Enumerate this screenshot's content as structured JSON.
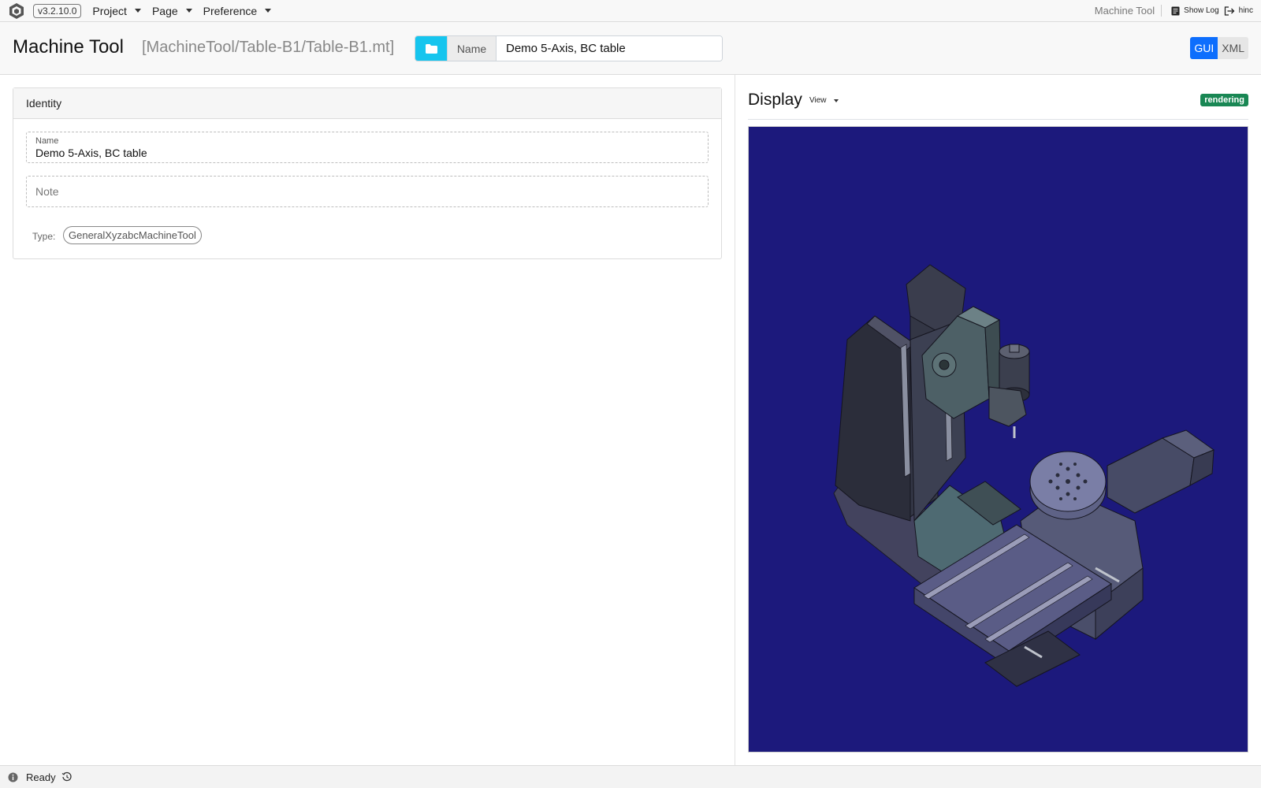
{
  "topbar": {
    "version": "v3.2.10.0",
    "menus": [
      {
        "label": "Project"
      },
      {
        "label": "Page"
      },
      {
        "label": "Preference"
      }
    ],
    "context": "Machine Tool",
    "show_log": "Show Log",
    "user": "hinc"
  },
  "header": {
    "title": "Machine Tool",
    "path": "[MachineTool/Table-B1/Table-B1.mt]",
    "name_addon": "Name",
    "name_value": "Demo 5-Axis, BC table",
    "gui_label": "GUI",
    "xml_label": "XML"
  },
  "identity": {
    "header": "Identity",
    "name_label": "Name",
    "name_value": "Demo 5-Axis, BC table",
    "note_placeholder": "Note",
    "type_label": "Type:",
    "type_value": "GeneralXyzabcMachineTool"
  },
  "display": {
    "title": "Display",
    "view_label": "View",
    "badge": "rendering",
    "background_color": "#1c197c"
  },
  "status": {
    "text": "Ready"
  },
  "colors": {
    "accent_cyan": "#16c5ee",
    "primary": "#0d6efd",
    "success": "#198754"
  }
}
